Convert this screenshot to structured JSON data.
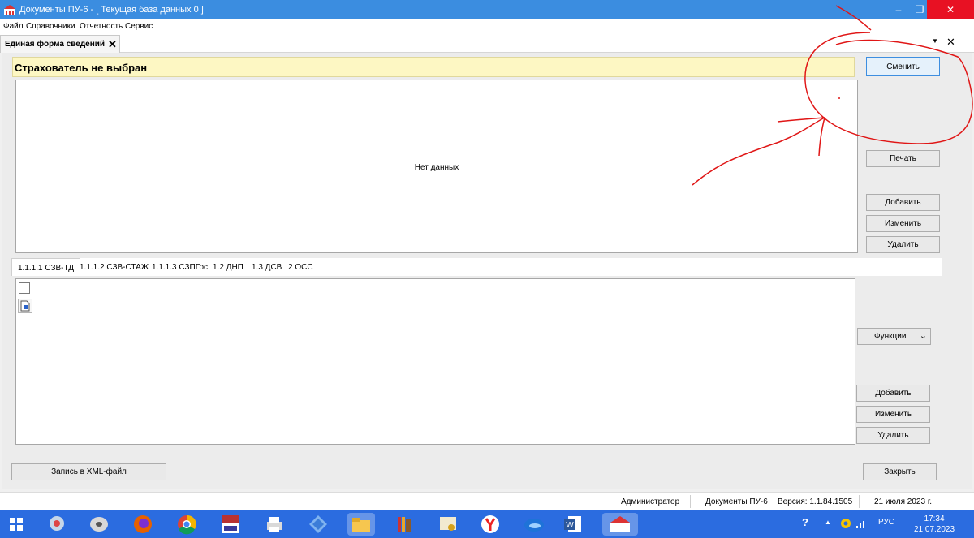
{
  "window": {
    "title": "Документы ПУ-6  -  [ Текущая база данных 0 ]",
    "titlebar_color": "#3b8de0",
    "controls": {
      "minimize": "–",
      "maximize": "❐",
      "close": "✕"
    }
  },
  "menu": [
    "Файл",
    "Справочники",
    "Отчетность",
    "Сервис"
  ],
  "document_tab": {
    "label": "Единая форма сведений",
    "close": "✕"
  },
  "tabstrip_controls": {
    "dropdown": "▼",
    "close": "✕"
  },
  "banner": {
    "text": "Страхователь не выбран",
    "color": "#fdf7c3"
  },
  "top_panel": {
    "empty_text": "Нет данных"
  },
  "top_buttons": {
    "change": "Сменить",
    "print": "Печать",
    "add": "Добавить",
    "edit": "Изменить",
    "delete": "Удалить"
  },
  "subtabs": [
    "1.1.1.1 СЗВ-ТД",
    "1.1.1.2 СЗВ-СТАЖ",
    "1.1.1.3 СЗПГос",
    "1.2 ДНП",
    "1.3 ДСВ",
    "2 ОСС"
  ],
  "bottom_buttons": {
    "functions": "Функции",
    "functions_arrow": "⌄",
    "add": "Добавить",
    "edit": "Изменить",
    "delete": "Удалить"
  },
  "footer_buttons": {
    "xml": "Запись в XML-файл",
    "close": "Закрыть"
  },
  "status": {
    "user": "Администратор",
    "app": "Документы ПУ-6",
    "version": "Версия: 1.1.84.1505",
    "date": "21 июля 2023 г."
  },
  "taskbar": {
    "color": "#2b6ce0",
    "icons": [
      "windows-start-icon",
      "network-tool-icon",
      "disk-tool-icon",
      "firefox-icon",
      "chrome-icon",
      "pdf-tool-icon",
      "printer-icon",
      "diamond-app-icon",
      "file-explorer-icon",
      "books-app-icon",
      "certificate-icon",
      "yandex-browser-icon",
      "edge-icon",
      "word-icon",
      "pu6-app-icon"
    ],
    "tray": {
      "help": "?",
      "language": "РУС",
      "time": "17:34",
      "date": "21.07.2023"
    }
  }
}
